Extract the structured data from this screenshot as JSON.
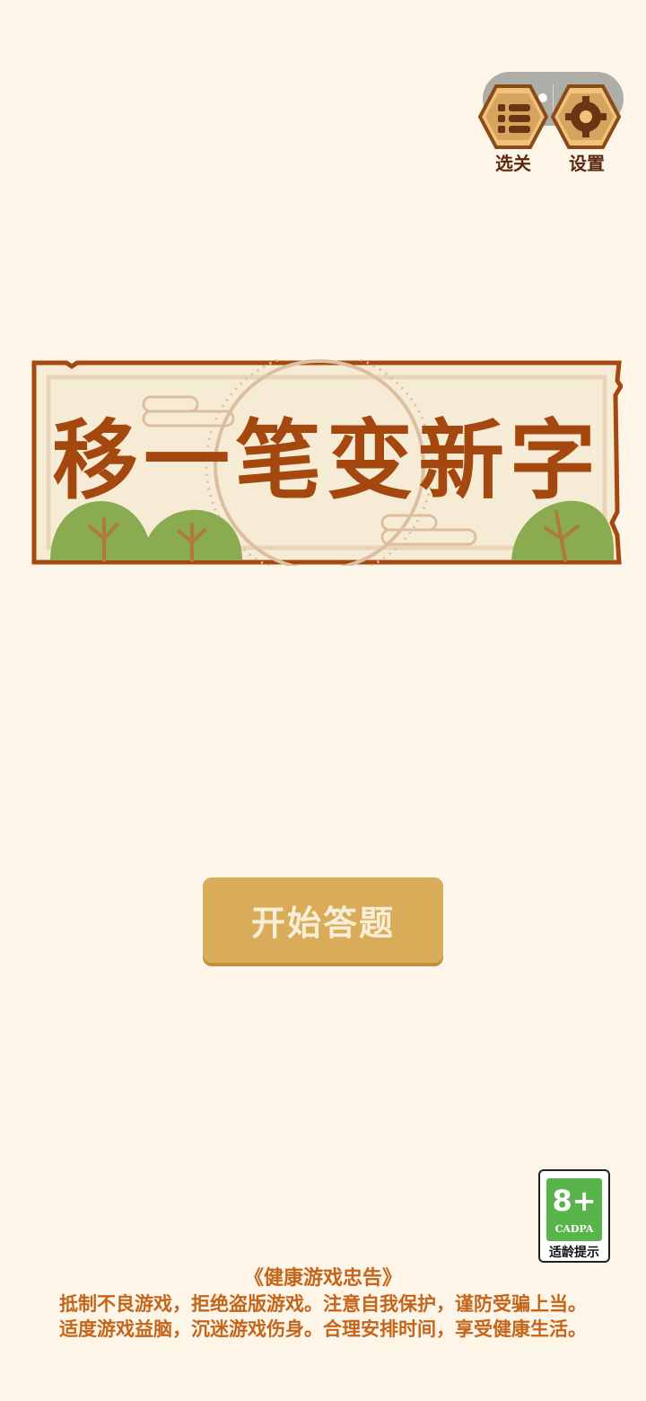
{
  "top_buttons": {
    "level_select_label": "选关",
    "settings_label": "设置"
  },
  "title": "移一笔变新字",
  "start_button_label": "开始答题",
  "age_rating": {
    "age": "8+",
    "org": "CADPA",
    "tip": "适龄提示"
  },
  "health_notice": {
    "title": "《健康游戏忠告》",
    "line1": "抵制不良游戏，拒绝盗版游戏。注意自我保护，谨防受骗上当。",
    "line2": "适度游戏益脑，沉迷游戏伤身。合理安排时间，享受健康生活。"
  },
  "colors": {
    "background": "#fdf6e8",
    "title": "#a5480f",
    "button": "#d9ac5a",
    "notice": "#c5651c"
  }
}
